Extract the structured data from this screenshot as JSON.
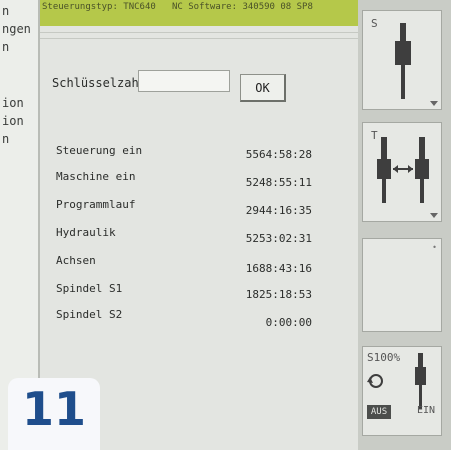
{
  "sidebar": {
    "items": [
      "n",
      "ngen",
      "n",
      "ion",
      "ion",
      "n"
    ]
  },
  "header": {
    "left_text": "Steuerungstyp: TNC640",
    "right_text": "NC Software: 340590 08 SP8"
  },
  "form": {
    "key_label": "Schlüsselzahl:",
    "key_value": "",
    "ok_label": "OK"
  },
  "stats": [
    {
      "label": "Steuerung ein",
      "value": "5564:58:28"
    },
    {
      "label": "Maschine ein",
      "value": "5248:55:11"
    },
    {
      "label": "Programmlauf",
      "value": "2944:16:35"
    },
    {
      "label": "Hydraulik",
      "value": "5253:02:31"
    },
    {
      "label": "Achsen",
      "value": "1688:43:16"
    },
    {
      "label": "Spindel S1",
      "value": "1825:18:53"
    },
    {
      "label": "Spindel S2",
      "value": "0:00:00"
    }
  ],
  "softkeys": {
    "s_label": "S",
    "t_label": "T",
    "override_label": "S100%",
    "aus_label": "AUS",
    "ein_label": "EIN"
  },
  "badge": {
    "number": "11"
  },
  "colors": {
    "header_green": "#b5c84a",
    "badge_blue": "#1f4e8c",
    "screen_bg": "#e3e5e1"
  }
}
